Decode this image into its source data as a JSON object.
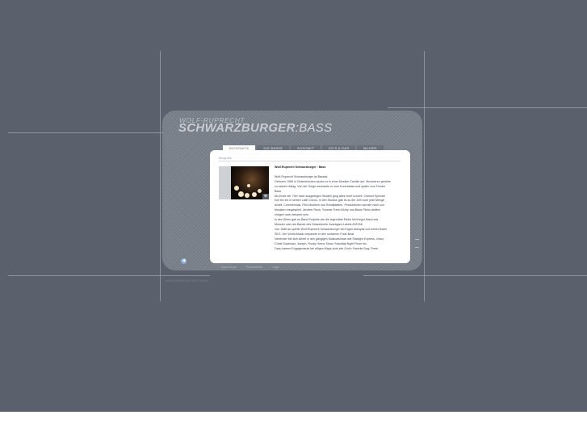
{
  "logo": {
    "top": "WOLF-RUPRECHT",
    "main": "SCHWARZBURGER",
    "suffix": ":BASS"
  },
  "nav": {
    "tabs": [
      {
        "label": "BIOGRAFIE",
        "active": true
      },
      {
        "label": "DIE BÄSSE",
        "active": false
      },
      {
        "label": "KONTAKT",
        "active": false
      },
      {
        "label": "CD'S & DAS",
        "active": false
      },
      {
        "label": "BILDER",
        "active": false
      }
    ]
  },
  "breadcrumb": "Biografie",
  "bio": {
    "heading": "Wolf-Ruprecht Schwarzburger : Bass",
    "lines": [
      "Wolf-Ruprecht Schwarzburger ist Bassist.",
      "Geboren 1966 in Gelsenkirchen wuchs er in einer Musiker-Familie auf. Musizieren gehörte",
      "zu seinem Alltag. Von der Geige wechselte er zum Kontrabass und später zum Fender",
      "Bass.",
      "Als Ende der 70er nach ausgiebigen Studien ging alles recht schnell. Christof Spendel",
      "holt ihn ein in seinen Latin Circus. In den Studios gab es zu der Zeit noch jede Menge",
      "Arbeit. Commercials, Film-Musiken und Schallplatten- Produktionen wurden noch von",
      "Musikern eingespielt. Jennifer Rush, Tommie Trent d'Arby und Black Flinks dürften",
      "einigen noch bekannt sein.",
      "In den 80ern gab es Band-Projekte wie die legendäre Eddie McGregor Band aus",
      "Münster oder die Bande des Düsseldorfer Avantgard-Labels ATATAK.",
      "Von 1986 an spielte Wolf-Ruprecht Schwarzburger bei Ergün Akkoyak und seiner Band",
      "SEG. Der World-Musik verpasste er den schweren Funk-Beat.",
      "Nebenher bei sich Arbeit in den gängigen Musicalshows wie Starlight Express, Jesus",
      "Christ Superstar, Joseph, Rocky Horror Show, Saturday Night Fever etc.",
      "Dazu kamen Engagements bei etligen Major-Acts wie God's Favorite Dog, Fresh"
    ]
  },
  "footer": {
    "links": [
      "Impressum",
      "Partnerlinks",
      "Login"
    ]
  },
  "footnote": "ASFAU BERATUNG SOFTWARE"
}
